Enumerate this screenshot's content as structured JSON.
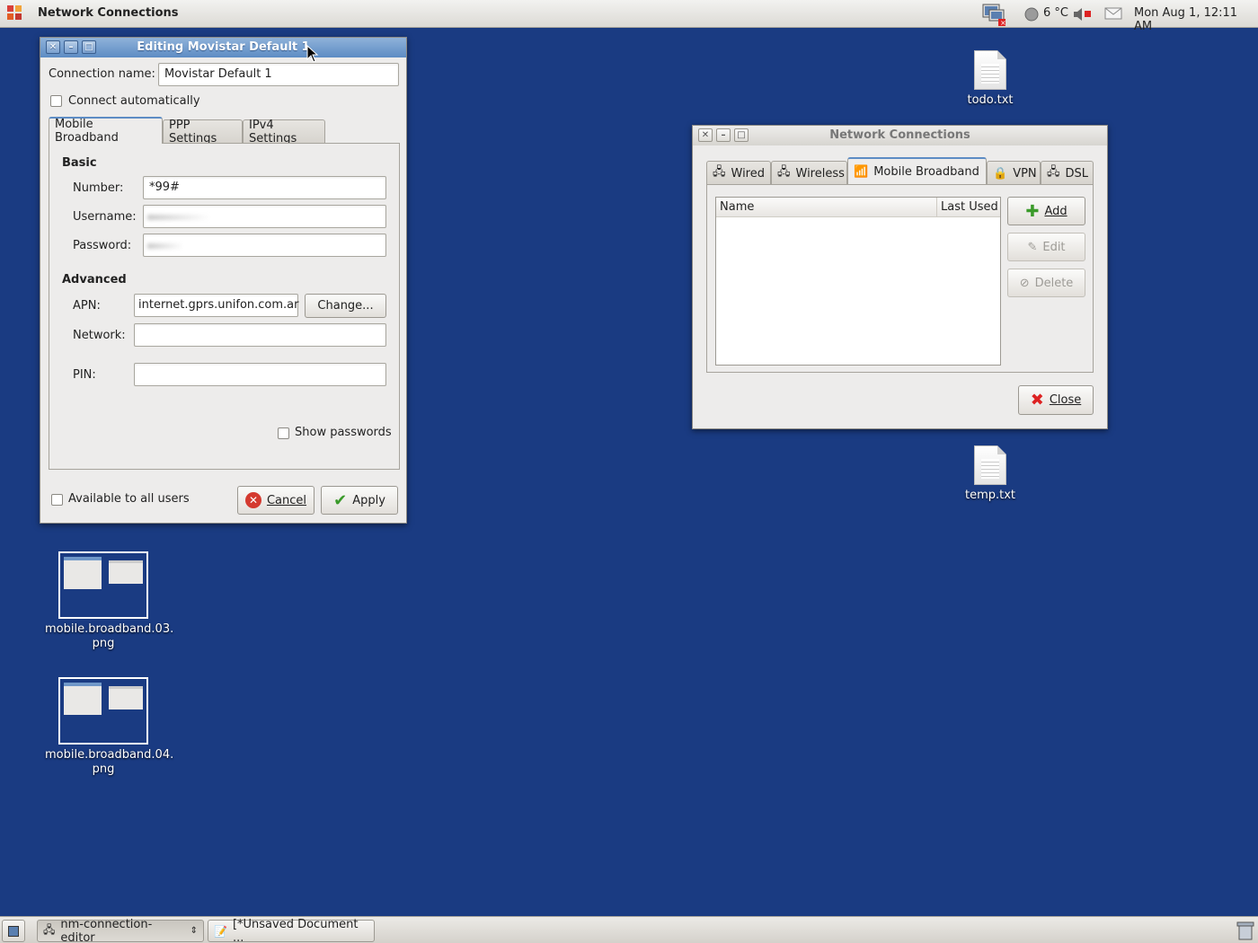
{
  "top_panel": {
    "app_title": "Network Connections",
    "temperature": "6 °C",
    "clock": "Mon Aug  1, 12:11 AM"
  },
  "desktop": {
    "icons": [
      {
        "label": "todo.txt"
      },
      {
        "label": "temp.txt"
      },
      {
        "label": "mobile.broadband.03.\npng"
      },
      {
        "label": "mobile.broadband.04.\npng"
      }
    ]
  },
  "edit_dialog": {
    "title": "Editing Movistar Default 1",
    "connection_name_label": "Connection name:",
    "connection_name_value": "Movistar Default 1",
    "connect_automatically": "Connect automatically",
    "tabs": [
      "Mobile Broadband",
      "PPP Settings",
      "IPv4 Settings"
    ],
    "basic_heading": "Basic",
    "number_label": "Number:",
    "number_value": "*99#",
    "username_label": "Username:",
    "password_label": "Password:",
    "advanced_heading": "Advanced",
    "apn_label": "APN:",
    "apn_value": "internet.gprs.unifon.com.ar",
    "change_button": "Change...",
    "network_label": "Network:",
    "pin_label": "PIN:",
    "show_passwords": "Show passwords",
    "available_all_users": "Available to all users",
    "cancel_button": "Cancel",
    "apply_button": "Apply"
  },
  "net_window": {
    "title": "Network Connections",
    "tabs": [
      "Wired",
      "Wireless",
      "Mobile Broadband",
      "VPN",
      "DSL"
    ],
    "columns": [
      "Name",
      "Last Used"
    ],
    "add_button": "Add",
    "edit_button": "Edit",
    "delete_button": "Delete",
    "close_button": "Close"
  },
  "taskbar": {
    "items": [
      "nm-connection-editor",
      "[*Unsaved Document ..."
    ]
  },
  "colors": {
    "desktop_bg": "#1a3b82",
    "titlebar_active": "#5d8cc4"
  }
}
